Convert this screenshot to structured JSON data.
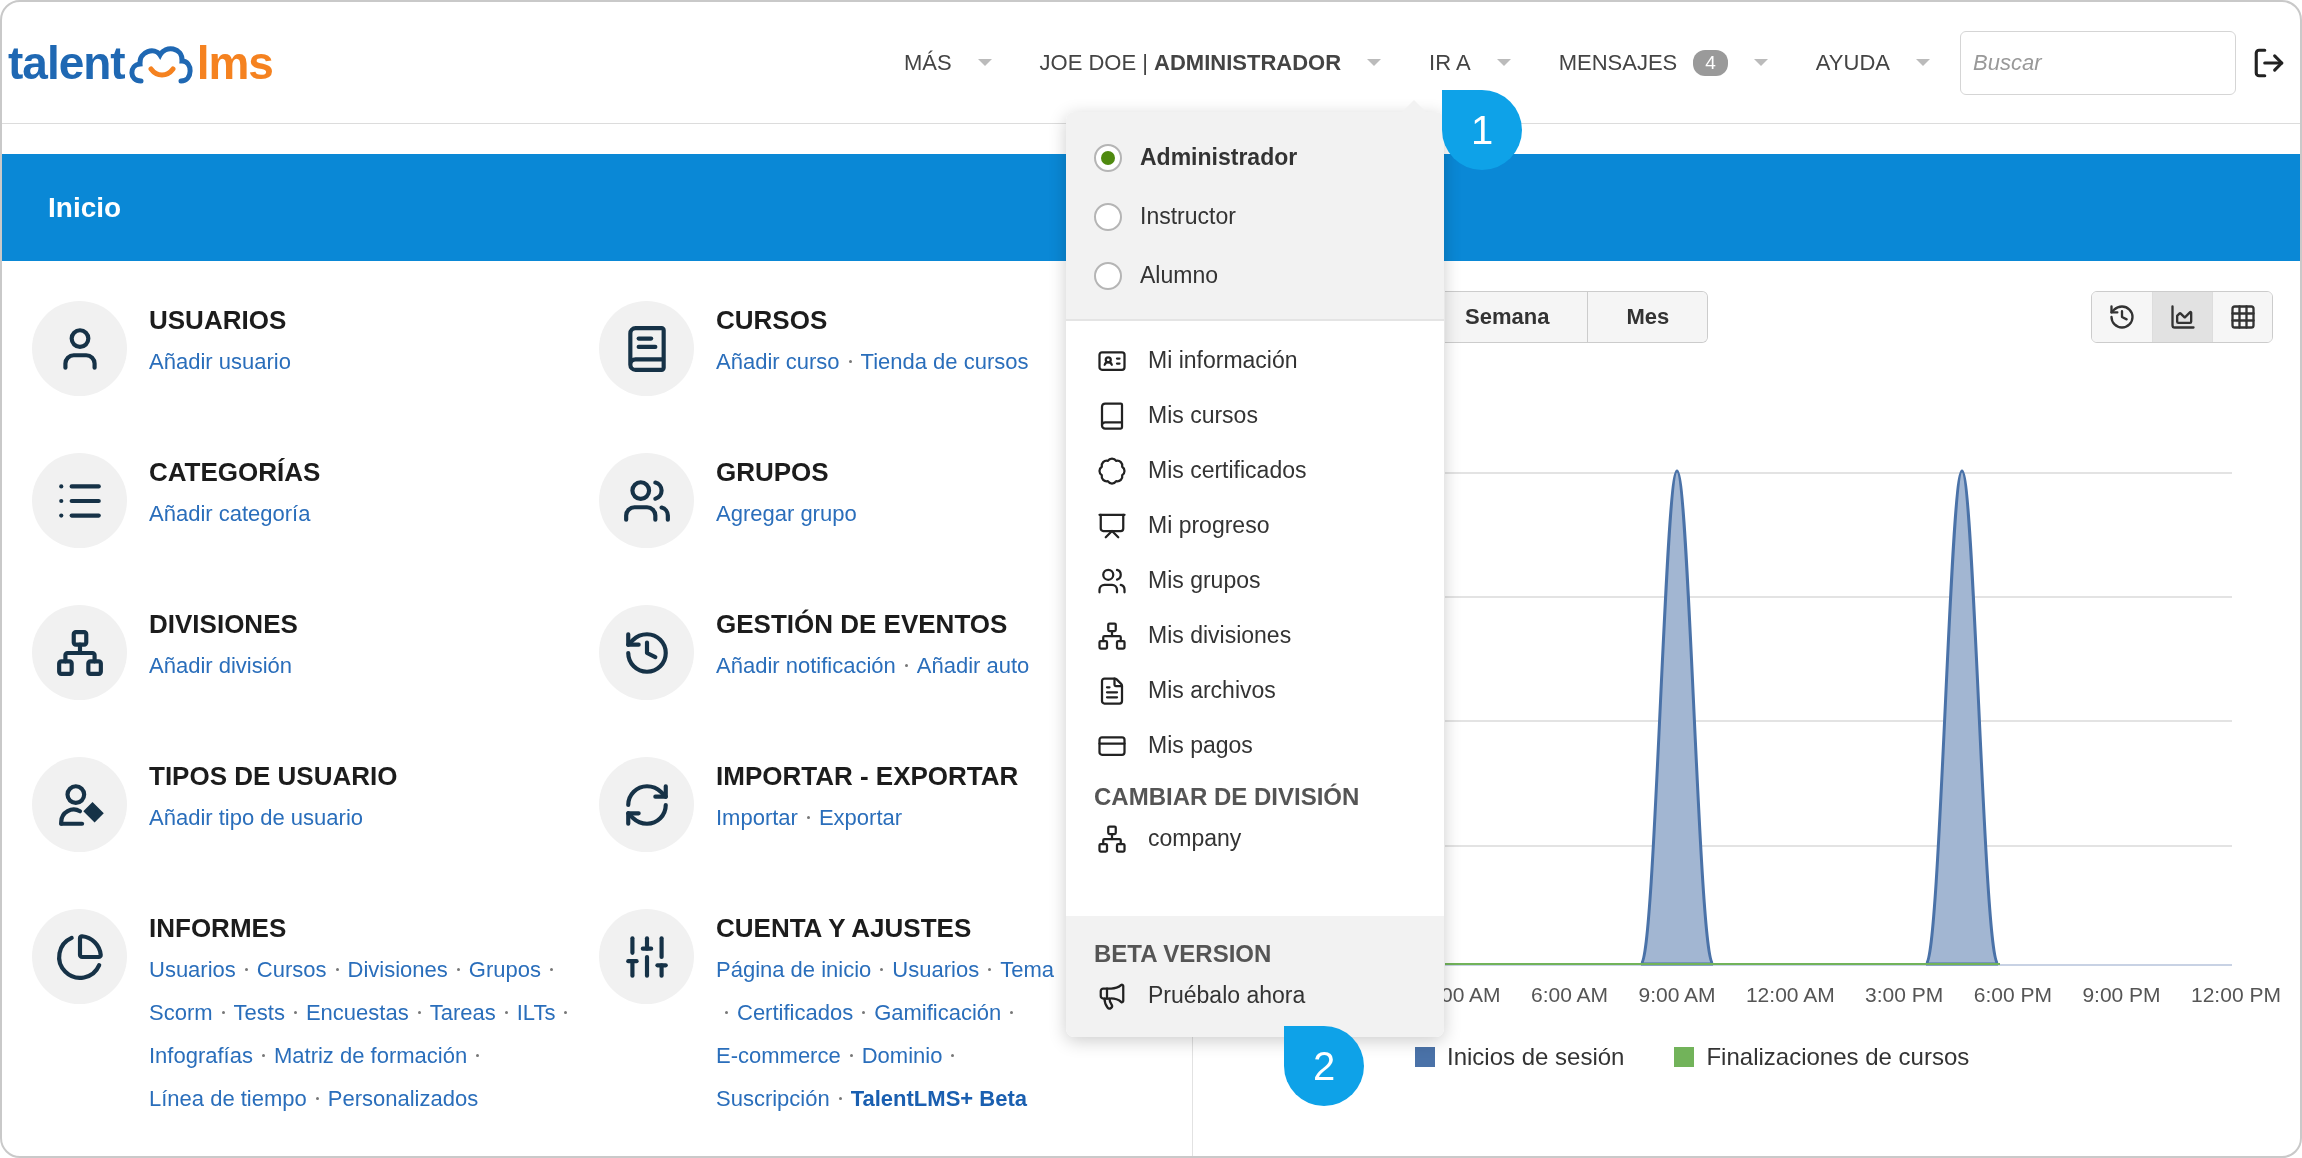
{
  "header": {
    "logo": {
      "left": "talent",
      "right": "lms"
    },
    "nav": [
      {
        "label": "MÁS"
      },
      {
        "label": "JOE DOE | **ADMINISTRADOR**"
      },
      {
        "label": "IR A"
      },
      {
        "label": "MENSAJES",
        "badge": "4"
      },
      {
        "label": "AYUDA"
      }
    ],
    "search": {
      "placeholder": "Buscar"
    }
  },
  "page_title": "Inicio",
  "cards": [
    {
      "title": "USUARIOS",
      "links": [
        {
          "label": "Añadir usuario"
        }
      ]
    },
    {
      "title": "CURSOS",
      "links": [
        {
          "label": "Añadir curso"
        },
        {
          "label": "Tienda de cursos"
        }
      ]
    },
    {
      "title": "CATEGORÍAS",
      "links": [
        {
          "label": "Añadir categoría"
        }
      ]
    },
    {
      "title": "GRUPOS",
      "links": [
        {
          "label": "Agregar grupo"
        }
      ]
    },
    {
      "title": "DIVISIONES",
      "links": [
        {
          "label": "Añadir división"
        }
      ]
    },
    {
      "title": "GESTIÓN DE EVENTOS",
      "links": [
        {
          "label": "Añadir notificación"
        },
        {
          "label": "Añadir auto"
        }
      ]
    },
    {
      "title": "TIPOS DE USUARIO",
      "links": [
        {
          "label": "Añadir tipo de usuario"
        }
      ]
    },
    {
      "title": "IMPORTAR - EXPORTAR",
      "links": [
        {
          "label": "Importar"
        },
        {
          "label": "Exportar"
        }
      ]
    },
    {
      "title": "INFORMES",
      "links": [
        {
          "label": "Usuarios"
        },
        {
          "label": "Cursos"
        },
        {
          "label": "Divisiones"
        },
        {
          "label": "Grupos"
        },
        {
          "label": "Scorm"
        },
        {
          "label": "Tests"
        },
        {
          "label": "Encuestas"
        },
        {
          "label": "Tareas"
        },
        {
          "label": "ILTs"
        },
        {
          "label": "Infografías"
        },
        {
          "label": "Matriz de formación"
        },
        {
          "label": "Línea de tiempo"
        },
        {
          "label": "Personalizados"
        }
      ]
    },
    {
      "title": "CUENTA Y AJUSTES",
      "links": [
        {
          "label": "Página de inicio"
        },
        {
          "label": "Usuarios"
        },
        {
          "label": "Tema"
        },
        {
          "label": "Certificados"
        },
        {
          "label": "Gamificación"
        },
        {
          "label": "E-commerce"
        },
        {
          "label": "Dominio"
        },
        {
          "label": "Suscripción"
        },
        {
          "label": "TalentLMS+ Beta",
          "strong": true
        }
      ]
    }
  ],
  "chart_panel": {
    "periods": [
      {
        "label": "Semana"
      },
      {
        "label": "Mes"
      }
    ],
    "views": [
      {
        "selected": false
      },
      {
        "selected": true
      },
      {
        "selected": false
      }
    ],
    "x_labels": [
      "00 AM",
      "6:00 AM",
      "9:00 AM",
      "12:00 AM",
      "3:00 PM",
      "6:00 PM",
      "9:00 PM",
      "12:00 PM"
    ],
    "legend": [
      {
        "label": "Inicios de sesión",
        "color": "#4a72a8"
      },
      {
        "label": "Finalizaciones de cursos",
        "color": "#72b35a"
      }
    ]
  },
  "user_menu": {
    "roles": [
      {
        "label": "Administrador",
        "selected": true
      },
      {
        "label": "Instructor",
        "selected": false
      },
      {
        "label": "Alumno",
        "selected": false
      }
    ],
    "items": [
      {
        "label": "Mi información"
      },
      {
        "label": "Mis cursos"
      },
      {
        "label": "Mis certificados"
      },
      {
        "label": "Mi progreso"
      },
      {
        "label": "Mis grupos"
      },
      {
        "label": "Mis divisiones"
      },
      {
        "label": "Mis archivos"
      },
      {
        "label": "Mis pagos"
      }
    ],
    "division": {
      "heading": "CAMBIAR DE DIVISIÓN",
      "items": [
        {
          "label": "company"
        }
      ]
    },
    "beta": {
      "heading": "BETA VERSION",
      "items": [
        {
          "label": "Pruébalo ahora"
        }
      ]
    }
  },
  "callouts": [
    {
      "label": "1"
    },
    {
      "label": "2"
    }
  ]
}
